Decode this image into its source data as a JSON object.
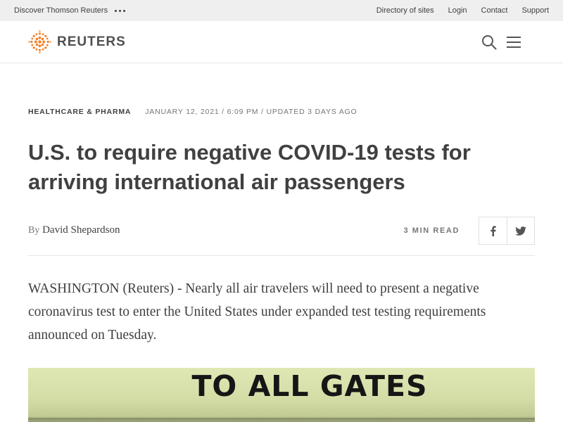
{
  "utility_bar": {
    "discover": "Discover Thomson Reuters",
    "links": [
      "Directory of sites",
      "Login",
      "Contact",
      "Support"
    ]
  },
  "header": {
    "logo_text": "REUTERS",
    "logo_color": "#f58025",
    "icons": [
      "search-icon",
      "hamburger-menu-icon"
    ]
  },
  "article": {
    "section": "Healthcare & Pharma",
    "dateline": "January 12, 2021 / 6:09 PM / Updated 3 days ago",
    "headline": "U.S. to require negative COVID-19 tests for arriving international air passengers",
    "byline_prefix": "By",
    "author": "David Shepardson",
    "read_time": "3 Min Read",
    "share": [
      "facebook-icon",
      "twitter-icon"
    ],
    "lede": "WASHINGTON (Reuters) - Nearly all air travelers will need to present a negative coronavirus test to enter the United States under expanded test testing requirements announced on Tuesday.",
    "photo_sign_text": "TO ALL GATES"
  }
}
